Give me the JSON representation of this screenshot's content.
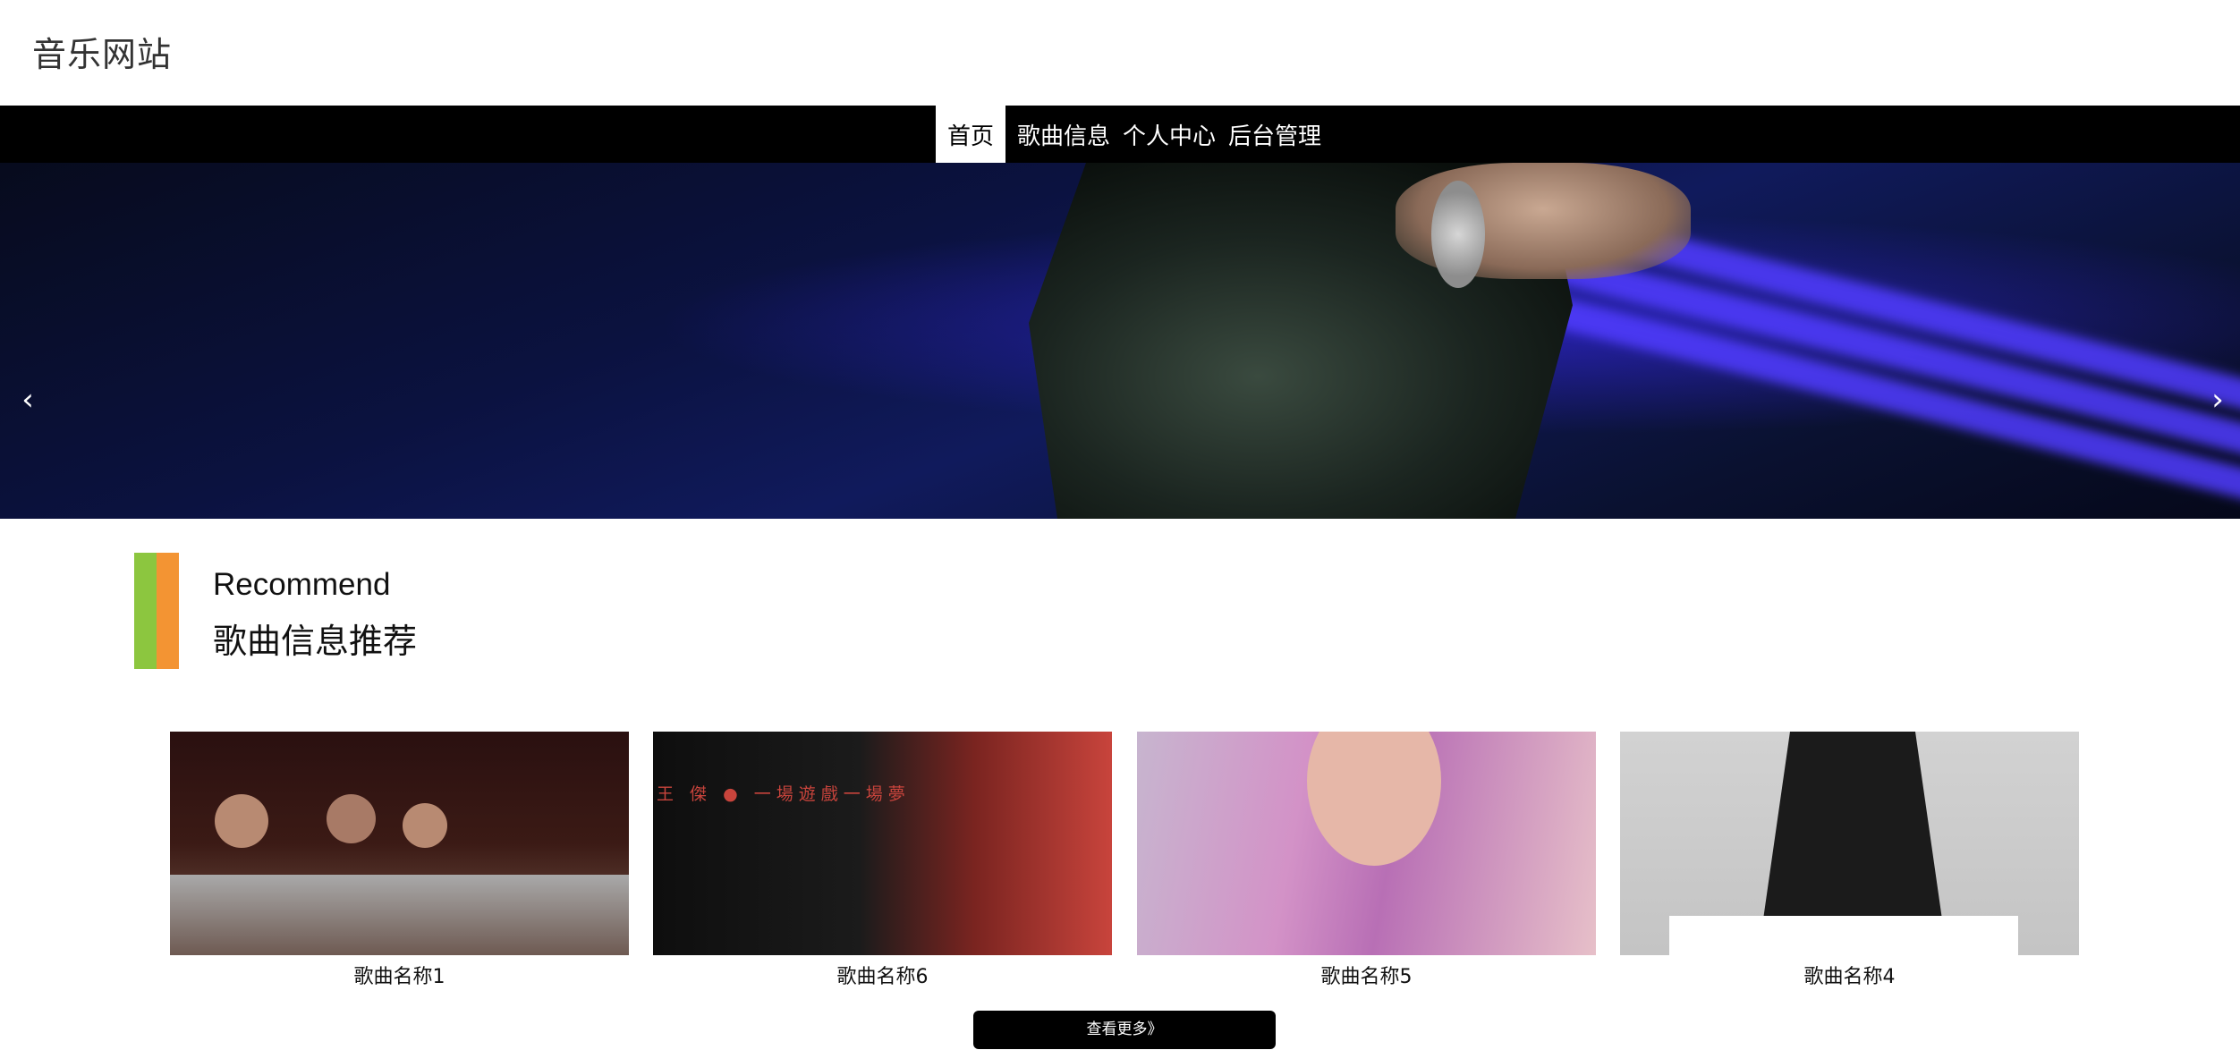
{
  "header": {
    "site_title": "音乐网站"
  },
  "nav": {
    "items": [
      {
        "label": "首页",
        "active": true
      },
      {
        "label": "歌曲信息",
        "active": false
      },
      {
        "label": "个人中心",
        "active": false
      },
      {
        "label": "后台管理",
        "active": false
      }
    ]
  },
  "carousel": {
    "prev_icon": "‹",
    "next_icon": "›",
    "slide_count": 3,
    "active_slide": 1
  },
  "recommend": {
    "title_en": "Recommend",
    "title_cn": "歌曲信息推荐",
    "accent_colors": [
      "#8cc63f",
      "#f39433"
    ]
  },
  "songs": [
    {
      "title": "歌曲名称1"
    },
    {
      "title": "歌曲名称6",
      "cover_text": "王 傑 ● 一場遊戲一場夢"
    },
    {
      "title": "歌曲名称5"
    },
    {
      "title": "歌曲名称4"
    }
  ],
  "more_button": {
    "label": "查看更多》"
  }
}
